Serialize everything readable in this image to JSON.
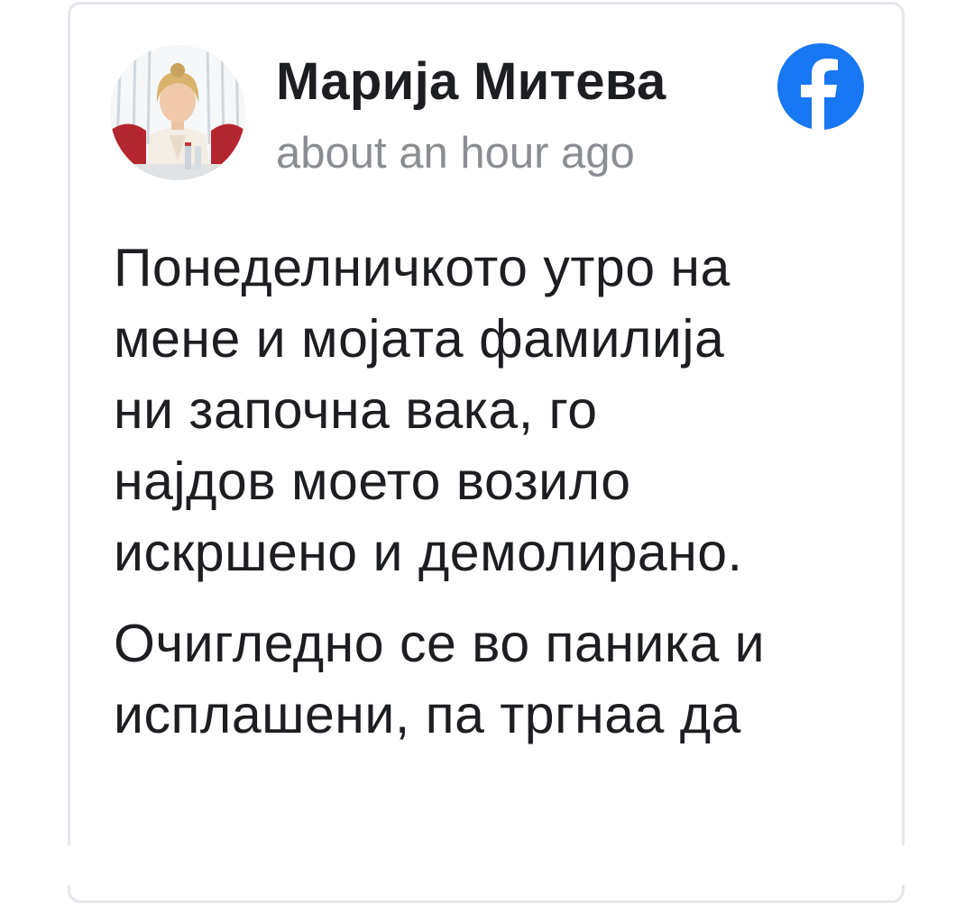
{
  "post": {
    "author": "Марија Митева",
    "timestamp": "about an hour ago",
    "source_icon": "facebook-icon",
    "paragraphs": [
      {
        "lines": [
          "Понеделничкото утро на",
          "мене и мојата фамилија",
          "ни започна вака, го",
          "најдов моето возило",
          "искршено и демолирано."
        ]
      },
      {
        "lines": [
          "Очигледно се во паника и",
          "исплашени, па тргнаа да"
        ]
      }
    ]
  },
  "colors": {
    "facebook_blue": "#1877f2",
    "text": "#1c1e21",
    "muted": "#8a8d91",
    "border": "#e4e6eb"
  }
}
